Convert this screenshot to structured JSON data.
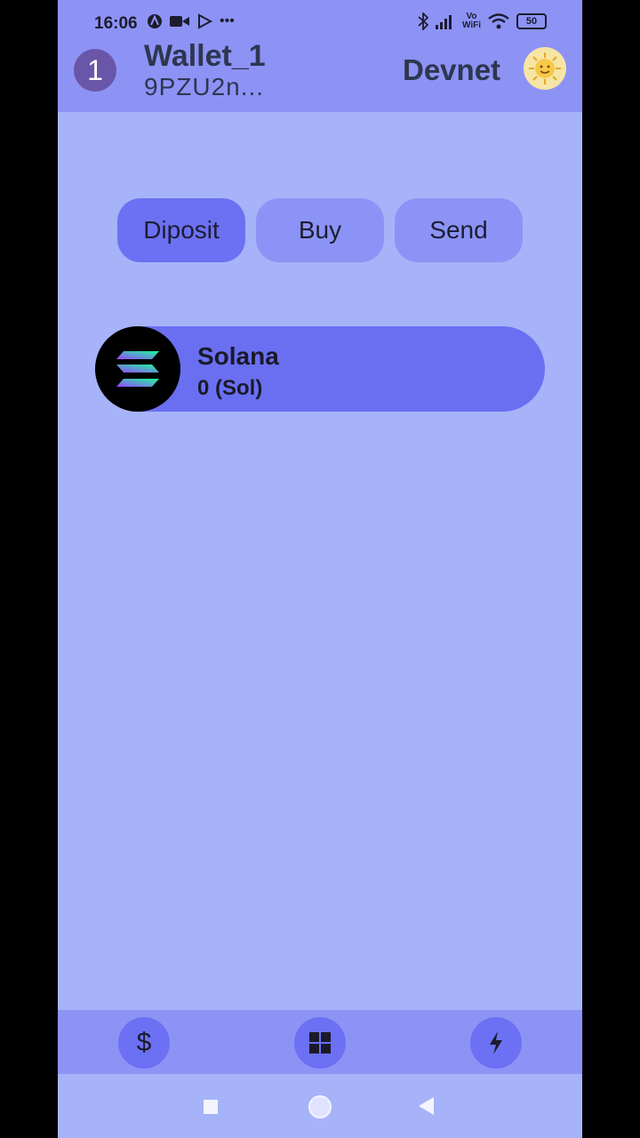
{
  "status_bar": {
    "time": "16:06",
    "battery": "50",
    "volte_line1": "Vo",
    "volte_line2": "WiFi"
  },
  "header": {
    "account_number": "1",
    "wallet_name": "Wallet_1",
    "wallet_address": "9PZU2n...",
    "network": "Devnet"
  },
  "actions": {
    "deposit_label": "Diposit",
    "buy_label": "Buy",
    "send_label": "Send"
  },
  "tokens": [
    {
      "name": "Solana",
      "balance": "0 (Sol)",
      "icon": "solana-logo"
    }
  ],
  "bottom_nav": {
    "items": [
      {
        "icon": "dollar-icon",
        "glyph": "$"
      },
      {
        "icon": "grid-icon"
      },
      {
        "icon": "lightning-icon"
      }
    ]
  },
  "colors": {
    "background": "#a6b3f8",
    "bar": "#8d93f5",
    "accent": "#6b71f2",
    "button": "#8c93f6"
  }
}
